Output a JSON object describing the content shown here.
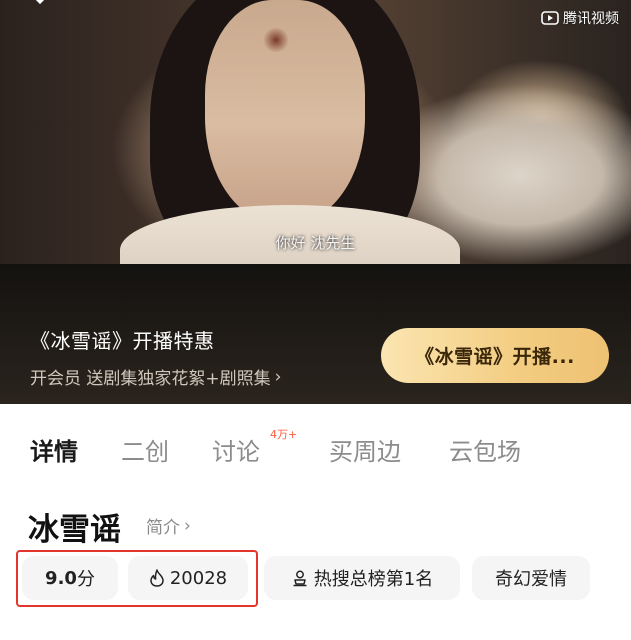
{
  "video": {
    "subtitle": "你好  沈先生",
    "brand": "腾讯视频",
    "brand_icon": "play-logo-icon",
    "back_icon": "back-arrow-icon"
  },
  "promo": {
    "title": "《冰雪谣》开播特惠",
    "subtitle": "开会员 送剧集独家花絮+剧照集",
    "subtitle_chevron": "›",
    "button_label": "《冰雪谣》开播..."
  },
  "tabs": [
    {
      "label": "详情",
      "active": true
    },
    {
      "label": "二创",
      "active": false
    },
    {
      "label": "讨论",
      "active": false,
      "badge": "4万+"
    },
    {
      "label": "买周边",
      "active": false
    },
    {
      "label": "云包场",
      "active": false
    }
  ],
  "show": {
    "title": "冰雪谣",
    "intro_label": "简介",
    "intro_chevron": "›"
  },
  "chips": {
    "score_value": "9.0",
    "score_unit": "分",
    "heat_icon": "flame-icon",
    "heat_value": "20028",
    "rank_icon": "trophy-icon",
    "rank_label": "热搜总榜第1名",
    "genre_label": "奇幻爱情"
  },
  "colors": {
    "highlight_border": "#e3352b",
    "promo_button": "#f3cd82",
    "badge": "#ff5a3c"
  }
}
